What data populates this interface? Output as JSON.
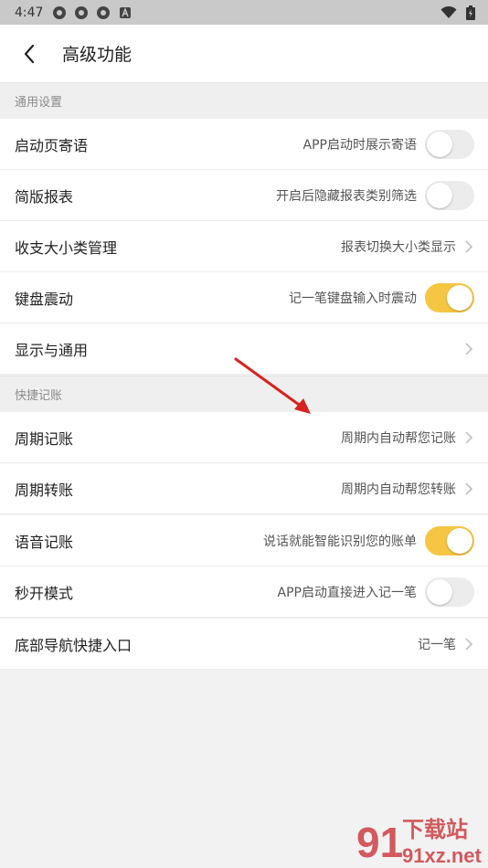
{
  "status_bar": {
    "time": "4:47",
    "icons": [
      "app-icon",
      "app-icon",
      "app-icon",
      "a-badge-icon"
    ],
    "wifi": "wifi-icon",
    "battery": "battery-icon"
  },
  "header": {
    "title": "高级功能",
    "back_icon": "chevron-left-icon"
  },
  "colors": {
    "accent": "#f6c642",
    "background": "#f2f2f2",
    "arrow": "#d9231e",
    "watermark": "#c8262b"
  },
  "sections": [
    {
      "title": "通用设置",
      "rows": [
        {
          "label": "启动页寄语",
          "desc": "APP启动时展示寄语",
          "control": "toggle",
          "on": false
        },
        {
          "label": "简版报表",
          "desc": "开启后隐藏报表类别筛选",
          "control": "toggle",
          "on": false
        },
        {
          "label": "收支大小类管理",
          "desc": "报表切换大小类显示",
          "control": "chevron"
        },
        {
          "label": "键盘震动",
          "desc": "记一笔键盘输入时震动",
          "control": "toggle",
          "on": true
        },
        {
          "label": "显示与通用",
          "desc": "",
          "control": "chevron"
        }
      ]
    },
    {
      "title": "快捷记账",
      "rows": [
        {
          "label": "周期记账",
          "desc": "周期内自动帮您记账",
          "control": "chevron"
        },
        {
          "label": "周期转账",
          "desc": "周期内自动帮您转账",
          "control": "chevron"
        },
        {
          "label": "语音记账",
          "desc": "说话就能智能识别您的账单",
          "control": "toggle",
          "on": true
        },
        {
          "label": "秒开模式",
          "desc": "APP启动直接进入记一笔",
          "control": "toggle",
          "on": false
        },
        {
          "label": "底部导航快捷入口",
          "desc": "记一笔",
          "control": "chevron"
        }
      ]
    }
  ],
  "watermark": {
    "logo": "91",
    "title": "下载站",
    "url": "91xz.net"
  }
}
